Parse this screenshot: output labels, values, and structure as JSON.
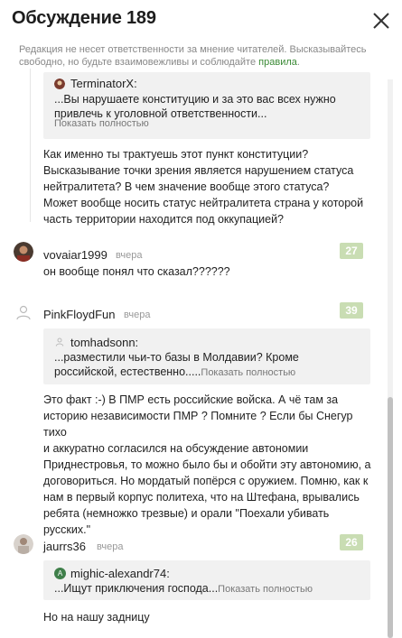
{
  "header": {
    "title": "Обсуждение 189",
    "close_icon": "close-icon"
  },
  "notice": {
    "text": "Редакция не несет ответственности за мнение читателей. Высказывайтесь свободно, но будьте взаимовежливы и соблюдайте ",
    "link": "правила",
    "end": "."
  },
  "comments": [
    {
      "quote": {
        "author": "TerminatorX:",
        "text": "...Вы нарушаете конституцию и за это вас всех нужно привлечь к уголовной ответственности...",
        "more": "Показать полностью"
      },
      "body": [
        "Как именно ты трактуешь этот пункт конституции?",
        "Высказывание точки зрения является нарушением статуса",
        "нейтралитета? В чем значение вообще этого статуса?",
        "Может вообще носить статус нейтралитета страна у которой",
        "часть территории находится под оккупацией?"
      ]
    },
    {
      "author": "vovaiar1999",
      "date": "вчера",
      "score": "27",
      "body": [
        "он вообще понял что сказал??????"
      ]
    },
    {
      "author": "PinkFloydFun",
      "date": "вчера",
      "score": "39",
      "quote": {
        "author": "tomhadsonn:",
        "text1": "...разместили чьи-то базы в Молдавии? Кроме",
        "text2": "российской, естественно.....",
        "more": "Показать полностью"
      },
      "body": [
        "Это факт :-) В ПМР есть российские войска. А чё там за",
        "историю независимости ПМР ? Помните ? Если бы Снегур тихо",
        "и аккуратно согласился на обсуждение автономии",
        "Приднестровья, то можно было бы и обойти эту автономию, а",
        "договориться. Но мордатый попёрся с оружием. Помню, как к",
        "нам в первый корпус политеха, что на Штефана, врывались",
        "ребята (немножко трезвые) и орали \"Поехали убивать",
        "русских.\""
      ]
    },
    {
      "author": "jaurrs36",
      "date": "вчера",
      "score": "26",
      "quote": {
        "author": "mighic-alexandr74:",
        "avatar_letter": "A",
        "text": "...Ищут приключения господа...",
        "more": "Показать полностью"
      },
      "body": [
        "Но на нашу задницу"
      ]
    }
  ],
  "colors": {
    "score_bg": "#c9ddb3",
    "link": "#3a8a35",
    "quote_bg": "#f1f1f1"
  }
}
